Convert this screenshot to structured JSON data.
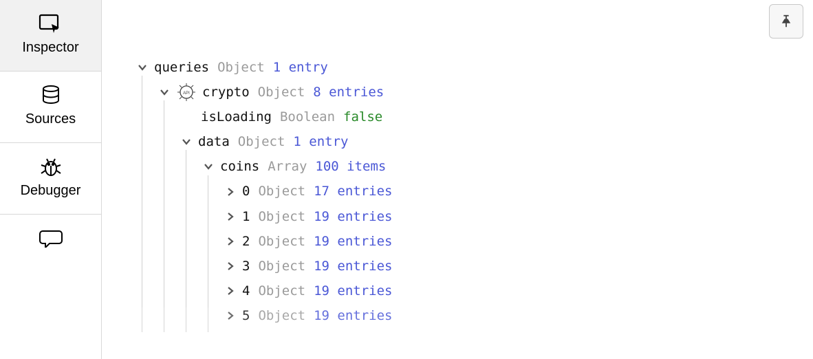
{
  "sidebar": {
    "items": [
      {
        "name": "inspector",
        "label": "Inspector",
        "active": true
      },
      {
        "name": "sources",
        "label": "Sources",
        "active": false
      },
      {
        "name": "debugger",
        "label": "Debugger",
        "active": false
      },
      {
        "name": "messages",
        "label": "",
        "active": false
      }
    ]
  },
  "tree": {
    "queries": {
      "key": "queries",
      "type": "Object",
      "entries": "1 entry",
      "crypto": {
        "key": "crypto",
        "type": "Object",
        "entries": "8 entries",
        "isLoading": {
          "key": "isLoading",
          "type": "Boolean",
          "value": "false"
        },
        "data": {
          "key": "data",
          "type": "Object",
          "entries": "1 entry",
          "coins": {
            "key": "coins",
            "type": "Array",
            "entries": "100 items",
            "items": [
              {
                "idx": "0",
                "type": "Object",
                "entries": "17 entries"
              },
              {
                "idx": "1",
                "type": "Object",
                "entries": "19 entries"
              },
              {
                "idx": "2",
                "type": "Object",
                "entries": "19 entries"
              },
              {
                "idx": "3",
                "type": "Object",
                "entries": "19 entries"
              },
              {
                "idx": "4",
                "type": "Object",
                "entries": "19 entries"
              },
              {
                "idx": "5",
                "type": "Object",
                "entries": "19 entries"
              }
            ]
          }
        }
      }
    }
  }
}
